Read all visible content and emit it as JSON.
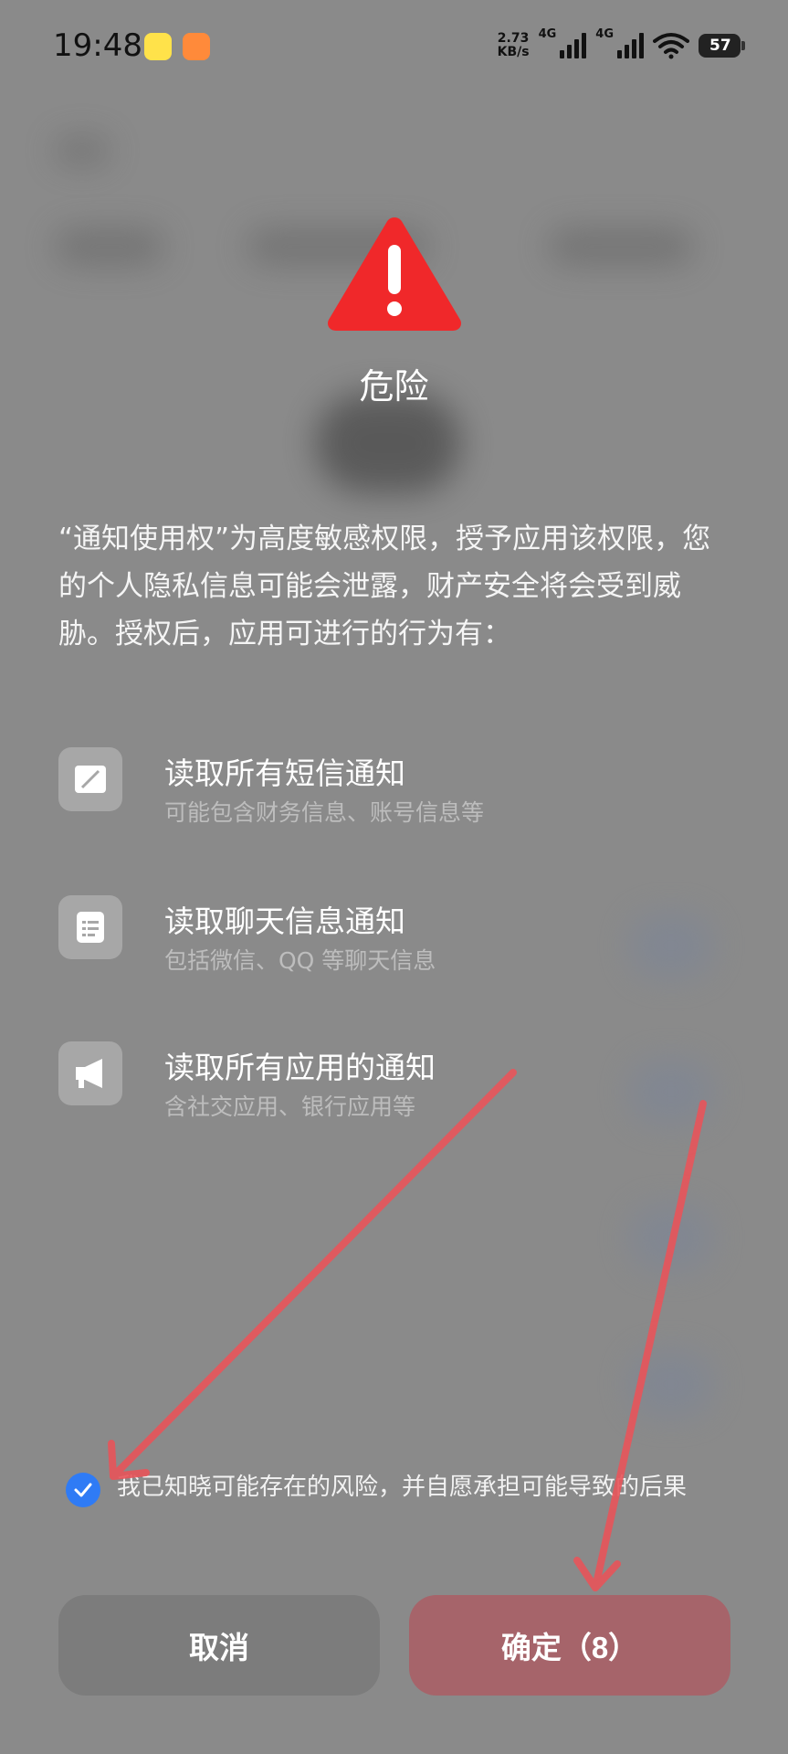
{
  "status_bar": {
    "time": "19:48",
    "net_speed_value": "2.73",
    "net_speed_unit": "KB/s",
    "signal1_label": "4G",
    "signal2_label": "4G",
    "battery": "57",
    "wifi_icon": "wifi-icon"
  },
  "dialog": {
    "title": "危险",
    "description": "“通知使用权”为高度敏感权限，授予应用该权限，您的个人隐私信息可能会泄露，财产安全将会受到威胁。授权后，应用可进行的行为有：",
    "items": [
      {
        "title": "读取所有短信通知",
        "subtitle": "可能包含财务信息、账号信息等",
        "icon": "sms-icon"
      },
      {
        "title": "读取聊天信息通知",
        "subtitle": "包括微信、QQ 等聊天信息",
        "icon": "chat-icon"
      },
      {
        "title": "读取所有应用的通知",
        "subtitle": "含社交应用、银行应用等",
        "icon": "megaphone-icon"
      }
    ],
    "consent_text": "我已知晓可能存在的风险，并自愿承担可能导致的后果",
    "consent_checked": true,
    "cancel_label": "取消",
    "confirm_label": "确定（8）"
  },
  "colors": {
    "warning": "#f0282a",
    "check": "#2f7bf5",
    "annotation_arrow": "#e8545a"
  }
}
